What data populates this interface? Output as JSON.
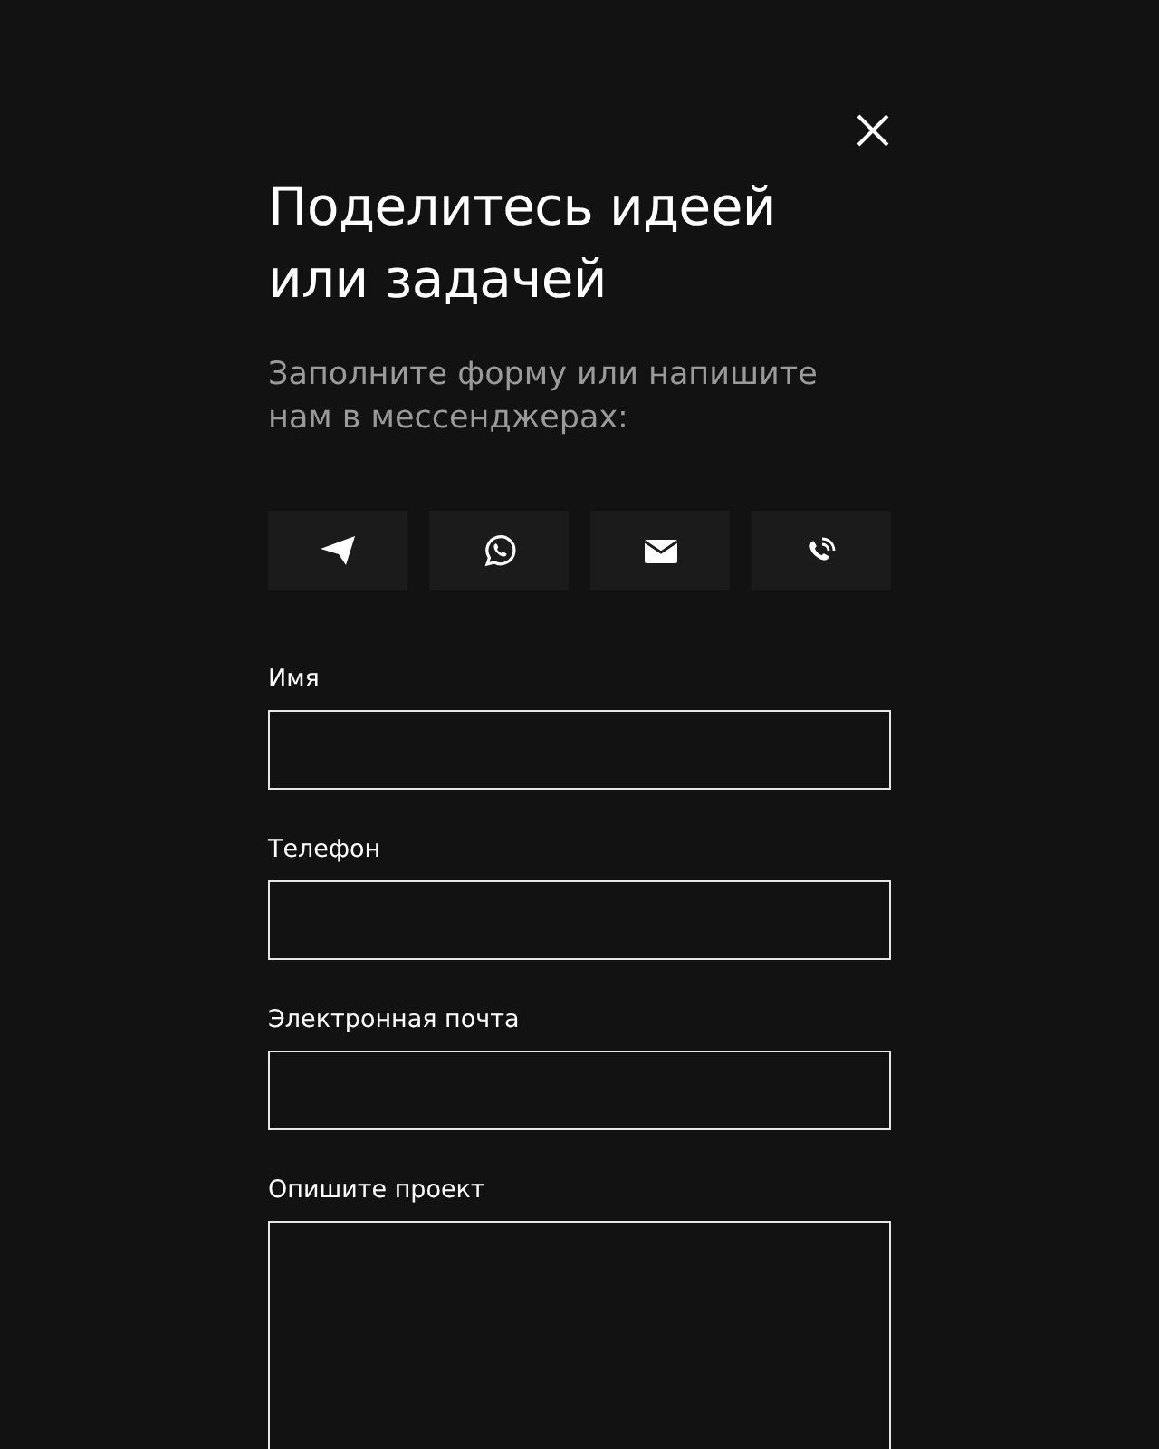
{
  "title": "Поделитесь идеей или задачей",
  "subtitle": "Заполните форму или напишите нам в мессенджерах:",
  "messengers": [
    {
      "kind": "telegram"
    },
    {
      "kind": "whatsapp"
    },
    {
      "kind": "email"
    },
    {
      "kind": "phone"
    }
  ],
  "fields": [
    {
      "label": "Имя",
      "kind": "input"
    },
    {
      "label": "Телефон",
      "kind": "input"
    },
    {
      "label": "Электронная почта",
      "kind": "input"
    },
    {
      "label": "Опишите проект",
      "kind": "textarea"
    }
  ]
}
